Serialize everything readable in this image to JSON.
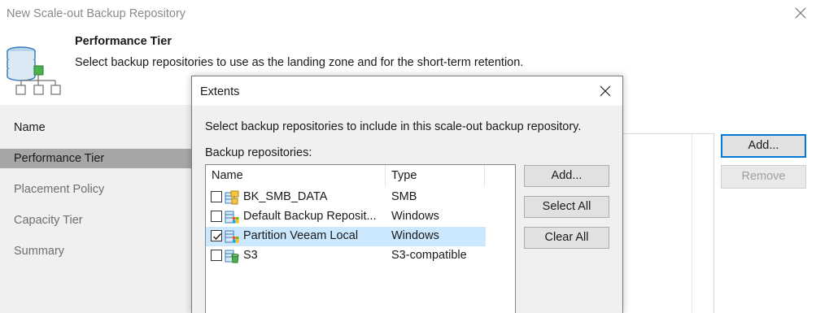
{
  "wizard": {
    "title": "New Scale-out Backup Repository",
    "heading": "Performance Tier",
    "subheading": "Select backup repositories to use as the landing zone and for the short-term retention.",
    "close_icon": "close-icon",
    "header_icon": "scale-out-repository-icon"
  },
  "nav": {
    "items": [
      {
        "label": "Name",
        "state": "completed"
      },
      {
        "label": "Performance Tier",
        "state": "active"
      },
      {
        "label": "Placement Policy",
        "state": "pending"
      },
      {
        "label": "Capacity Tier",
        "state": "pending"
      },
      {
        "label": "Summary",
        "state": "pending"
      }
    ]
  },
  "wizard_buttons": {
    "add_label": "Add...",
    "remove_label": "Remove"
  },
  "dialog": {
    "title": "Extents",
    "description": "Select backup repositories to include in this scale-out backup repository.",
    "list_label": "Backup repositories:",
    "columns": {
      "name": "Name",
      "type": "Type"
    },
    "rows": [
      {
        "name": "BK_SMB_DATA",
        "type": "SMB",
        "checked": false,
        "icon": "smb-share-repository-icon"
      },
      {
        "name": "Default Backup Reposit...",
        "type": "Windows",
        "checked": false,
        "icon": "windows-repository-icon"
      },
      {
        "name": "Partition Veeam Local",
        "type": "Windows",
        "checked": true,
        "icon": "windows-repository-icon"
      },
      {
        "name": "S3",
        "type": "S3-compatible",
        "checked": false,
        "icon": "s3-object-storage-icon"
      }
    ],
    "buttons": {
      "add_label": "Add...",
      "select_all_label": "Select All",
      "clear_all_label": "Clear All"
    }
  },
  "colors": {
    "selection": "#cce8ff",
    "accent": "#0078d7",
    "nav_active": "#a6a6a6",
    "nav_bg": "#f0f0f0",
    "icon_green": "#4caf50"
  }
}
